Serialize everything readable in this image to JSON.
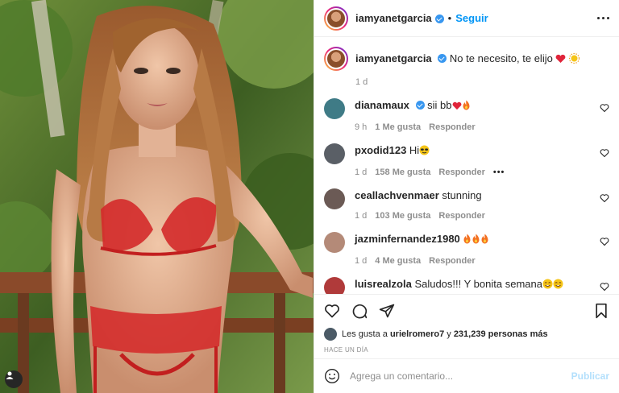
{
  "post": {
    "author": "iamyanetgarcia",
    "follow_label": "Seguir",
    "dot": "•",
    "caption": "No te necesito, te elijo",
    "caption_time": "1 d"
  },
  "comments": [
    {
      "user": "dianamaux",
      "verified": true,
      "text": "sii bb",
      "emoji": [
        "heart",
        "fire"
      ],
      "time": "9 h",
      "likes": "1 Me gusta",
      "reply": "Responder",
      "avatar_color": "#3f7b86"
    },
    {
      "user": "pxodid123",
      "verified": false,
      "text": "Hi",
      "emoji": [
        "sunglasses"
      ],
      "time": "1 d",
      "likes": "158 Me gusta",
      "reply": "Responder",
      "dots": "•••",
      "avatar_color": "#5a5f66"
    },
    {
      "user": "ceallachvenmaer",
      "verified": false,
      "text": "stunning",
      "emoji": [],
      "time": "1 d",
      "likes": "103 Me gusta",
      "reply": "Responder",
      "avatar_color": "#6b5a55"
    },
    {
      "user": "jazminfernandez1980",
      "verified": false,
      "text": "",
      "emoji": [
        "fire",
        "fire",
        "fire"
      ],
      "time": "1 d",
      "likes": "4 Me gusta",
      "reply": "Responder",
      "avatar_color": "#b48a78"
    },
    {
      "user": "luisrealzola",
      "verified": false,
      "text": "Saludos!!! Y bonita semana",
      "emoji": [
        "smile",
        "smile"
      ],
      "time": "",
      "likes": "",
      "reply": "",
      "avatar_color": "#b03a3a"
    }
  ],
  "likes": {
    "prefix": "Les gusta a",
    "user": "urielromero7",
    "conj": "y",
    "count": "231,239 personas más"
  },
  "posted_ago": "HACE UN DÍA",
  "compose": {
    "placeholder": "Agrega un comentario...",
    "publish_label": "Publicar"
  },
  "colors": {
    "accent": "#0095f6",
    "publish_disabled": "#b2dffc",
    "muted": "#8e8e8e",
    "verified": "#3897f0"
  }
}
